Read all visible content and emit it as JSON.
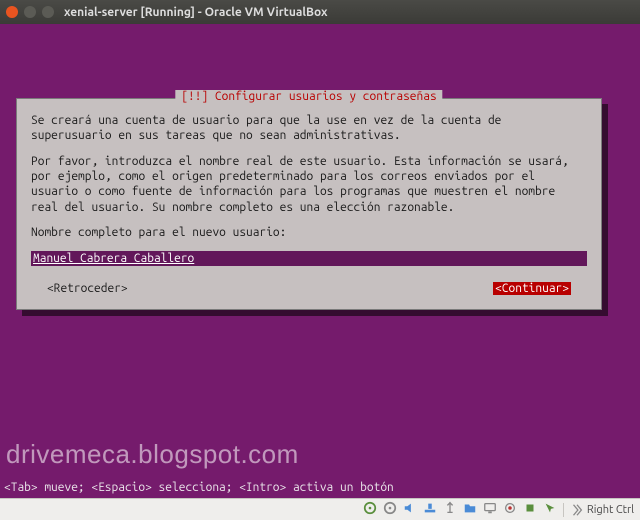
{
  "window": {
    "title": "xenial-server [Running] - Oracle VM VirtualBox"
  },
  "dialog": {
    "title": "[!!] Configurar usuarios y contraseñas",
    "para1": "Se creará una cuenta de usuario para que la use en vez de la cuenta de superusuario en sus tareas que no sean administrativas.",
    "para2": "Por favor, introduzca el nombre real de este usuario. Esta información se usará, por ejemplo, como el origen predeterminado para los correos enviados por el usuario o como fuente de información para los programas que muestren el nombre real del usuario. Su nombre completo es una elección razonable.",
    "field_label": "Nombre completo para el nuevo usuario:",
    "field_value": "Manuel Cabrera Caballero",
    "back_label": "<Retroceder>",
    "continue_label": "<Continuar>"
  },
  "helpbar": "<Tab> mueve; <Espacio> selecciona; <Intro> activa un botón",
  "watermark": "drivemeca.blogspot.com",
  "statusbar": {
    "hostkey": "Right Ctrl"
  }
}
